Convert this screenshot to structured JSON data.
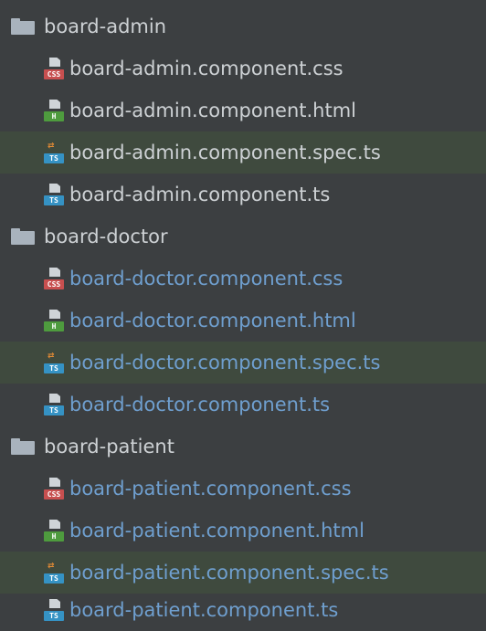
{
  "tree": {
    "rows": [
      {
        "type": "folder",
        "label": "board-admin"
      },
      {
        "type": "file",
        "label": "board-admin.component.css",
        "icon": "css-file-icon",
        "tag": "CSS"
      },
      {
        "type": "file",
        "label": "board-admin.component.html",
        "icon": "html-file-icon",
        "tag": "H"
      },
      {
        "type": "file",
        "label": "board-admin.component.spec.ts",
        "icon": "ts-spec-file-icon",
        "tag": "TS"
      },
      {
        "type": "file",
        "label": "board-admin.component.ts",
        "icon": "ts-file-icon",
        "tag": "TS"
      },
      {
        "type": "folder",
        "label": "board-doctor"
      },
      {
        "type": "file",
        "label": "board-doctor.component.css",
        "icon": "css-file-icon",
        "tag": "CSS"
      },
      {
        "type": "file",
        "label": "board-doctor.component.html",
        "icon": "html-file-icon",
        "tag": "H"
      },
      {
        "type": "file",
        "label": "board-doctor.component.spec.ts",
        "icon": "ts-spec-file-icon",
        "tag": "TS"
      },
      {
        "type": "file",
        "label": "board-doctor.component.ts",
        "icon": "ts-file-icon",
        "tag": "TS"
      },
      {
        "type": "folder",
        "label": "board-patient"
      },
      {
        "type": "file",
        "label": "board-patient.component.css",
        "icon": "css-file-icon",
        "tag": "CSS"
      },
      {
        "type": "file",
        "label": "board-patient.component.html",
        "icon": "html-file-icon",
        "tag": "H"
      },
      {
        "type": "file",
        "label": "board-patient.component.spec.ts",
        "icon": "ts-spec-file-icon",
        "tag": "TS"
      },
      {
        "type": "file",
        "label": "board-patient.component.ts",
        "icon": "ts-file-icon",
        "tag": "TS"
      }
    ]
  },
  "colors": {
    "background": "#3c3f41",
    "spec_highlight": "#3f4a3e",
    "default_text": "#cdd1d4",
    "modified_text": "#6f9fcf"
  }
}
